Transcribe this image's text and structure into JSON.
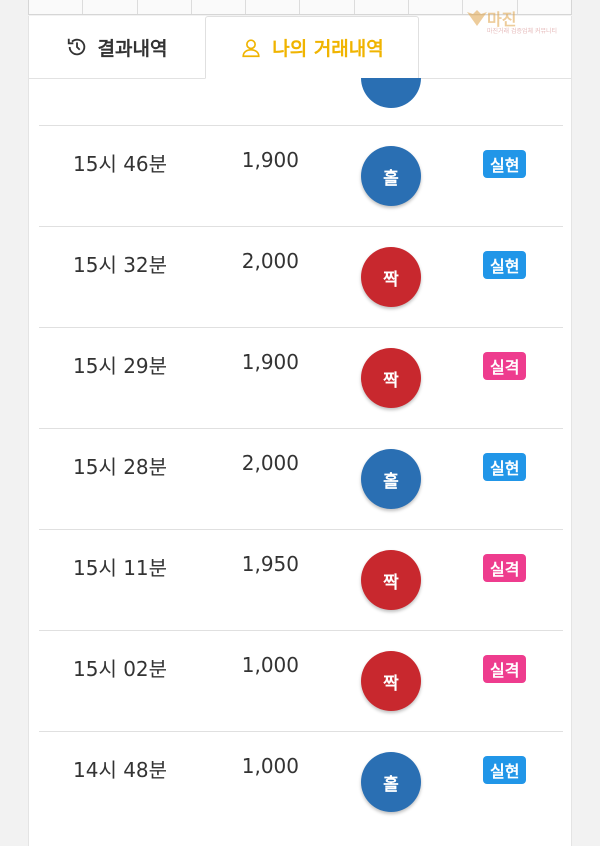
{
  "watermark": {
    "brand": "마진",
    "tagline": "마진거래 검증업체 커뮤니티"
  },
  "tabs": [
    {
      "label": "결과내역",
      "icon": "history-icon",
      "active": false
    },
    {
      "label": "나의 거래내역",
      "icon": "user-icon",
      "active": true
    }
  ],
  "colors": {
    "accent": "#f0b400",
    "odd_ball": "#2a6fb3",
    "even_ball": "#c8282e",
    "win_badge": "#2196e8",
    "lose_badge": "#ee3c8e"
  },
  "trades": [
    {
      "time": "15시 46분",
      "amount": "1,900",
      "pick": "홀",
      "pick_type": "odd",
      "result": "실현",
      "result_type": "win"
    },
    {
      "time": "15시 32분",
      "amount": "2,000",
      "pick": "짝",
      "pick_type": "even",
      "result": "실현",
      "result_type": "win"
    },
    {
      "time": "15시 29분",
      "amount": "1,900",
      "pick": "짝",
      "pick_type": "even",
      "result": "실격",
      "result_type": "lose"
    },
    {
      "time": "15시 28분",
      "amount": "2,000",
      "pick": "홀",
      "pick_type": "odd",
      "result": "실현",
      "result_type": "win"
    },
    {
      "time": "15시 11분",
      "amount": "1,950",
      "pick": "짝",
      "pick_type": "even",
      "result": "실격",
      "result_type": "lose"
    },
    {
      "time": "15시 02분",
      "amount": "1,000",
      "pick": "짝",
      "pick_type": "even",
      "result": "실격",
      "result_type": "lose"
    },
    {
      "time": "14시 48분",
      "amount": "1,000",
      "pick": "홀",
      "pick_type": "odd",
      "result": "실현",
      "result_type": "win"
    }
  ]
}
